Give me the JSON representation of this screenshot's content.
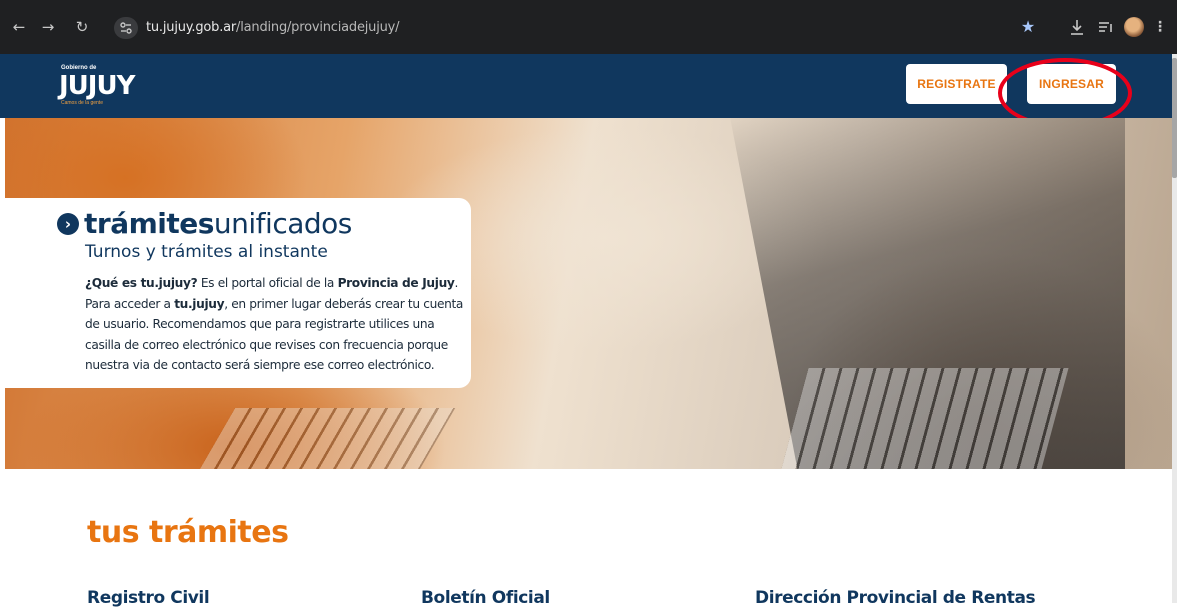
{
  "browser": {
    "url_host": "tu.jujuy.gob.ar",
    "url_path": "/landing/provinciadejujuy/",
    "back_icon": "arrow-left-icon",
    "forward_icon": "arrow-right-icon",
    "reload_icon": "reload-icon",
    "star_icon": "star-icon",
    "download_icon": "download-icon",
    "reading_list_icon": "reading-list-icon",
    "menu_icon": "kebab-menu-icon"
  },
  "header": {
    "logo_small": "Gobierno de",
    "logo_main": "JUJUY",
    "logo_tag": "Camos de la gente",
    "register_label": "REGISTRATE",
    "login_label": "INGRESAR",
    "accent_color": "#e87511",
    "brand_color": "#10375e",
    "annotation_color": "#e8001a"
  },
  "hero": {
    "title_bold": "trámites",
    "title_light": "unificados",
    "subtitle": "Turnos y trámites al instante",
    "p_q": "¿Qué es tu.jujuy?",
    "p_1": " Es el portal oficial de la ",
    "p_province": "Provincia de Jujuy",
    "p_2": ".",
    "p_3": "Para acceder a ",
    "p_brand": "tu.jujuy",
    "p_4": ", en primer lugar deberás crear tu cuenta",
    "p_5": "de usuario. Recomendamos que para registrarte utilices una",
    "p_6": "casilla de correo electrónico que revises con frecuencia porque",
    "p_7": "nuestra via de contacto será siempre ese correo electrónico."
  },
  "section": {
    "title": "tus trámites",
    "items": [
      {
        "label": "Registro Civil"
      },
      {
        "label": "Boletín Oficial"
      },
      {
        "label": "Dirección Provincial de Rentas"
      }
    ]
  }
}
